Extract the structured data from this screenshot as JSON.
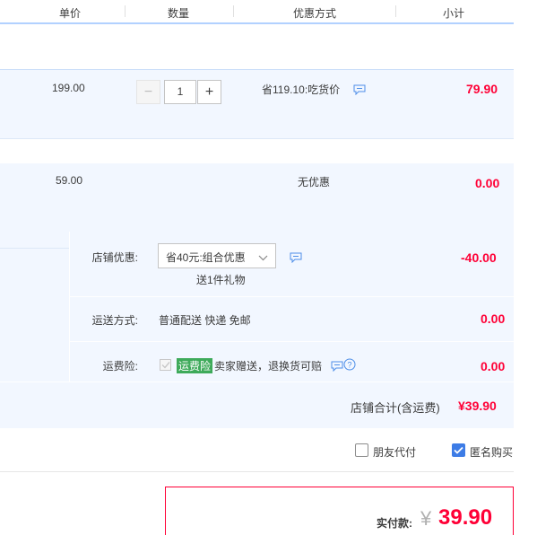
{
  "header": {
    "col_unit_price": "单价",
    "col_quantity": "数量",
    "col_discount": "优惠方式",
    "col_subtotal": "小计"
  },
  "items": [
    {
      "unit_price": "199.00",
      "quantity": "1",
      "discount": "省119.10:吃货价",
      "subtotal": "79.90",
      "minus_label": "−",
      "plus_label": "+"
    },
    {
      "unit_price": "59.00",
      "discount": "无优惠",
      "subtotal": "0.00"
    }
  ],
  "shop": {
    "promo_label": "店铺优惠:",
    "promo_selected": "省40元:组合优惠",
    "promo_gift": "送1件礼物",
    "promo_amount": "-40.00",
    "shipping_label": "运送方式:",
    "shipping_value": "普通配送 快递 免邮",
    "shipping_amount": "0.00",
    "insurance_label": "运费险:",
    "insurance_badge": "运费险",
    "insurance_desc": "卖家赠送，退换货可赔",
    "insurance_amount": "0.00",
    "total_label": "店铺合计(含运费)",
    "total_value": "¥39.90"
  },
  "options": {
    "friend_pay_label": "朋友代付",
    "friend_pay_checked": false,
    "anonymous_label": "匿名购买",
    "anonymous_checked": true
  },
  "payment": {
    "label": "实付款:",
    "currency": "¥",
    "amount": "39.90"
  },
  "colors": {
    "accent_red": "#ff0036",
    "row_bg": "#f2f7ff",
    "header_line": "#b2d1ff",
    "badge_green": "#3eaa5a",
    "checkbox_blue": "#3d7ce6"
  },
  "icons": {
    "message": "message-bubble-icon",
    "help": "question-circle-icon",
    "dropdown": "chevron-down-icon",
    "check": "checkmark-icon"
  }
}
